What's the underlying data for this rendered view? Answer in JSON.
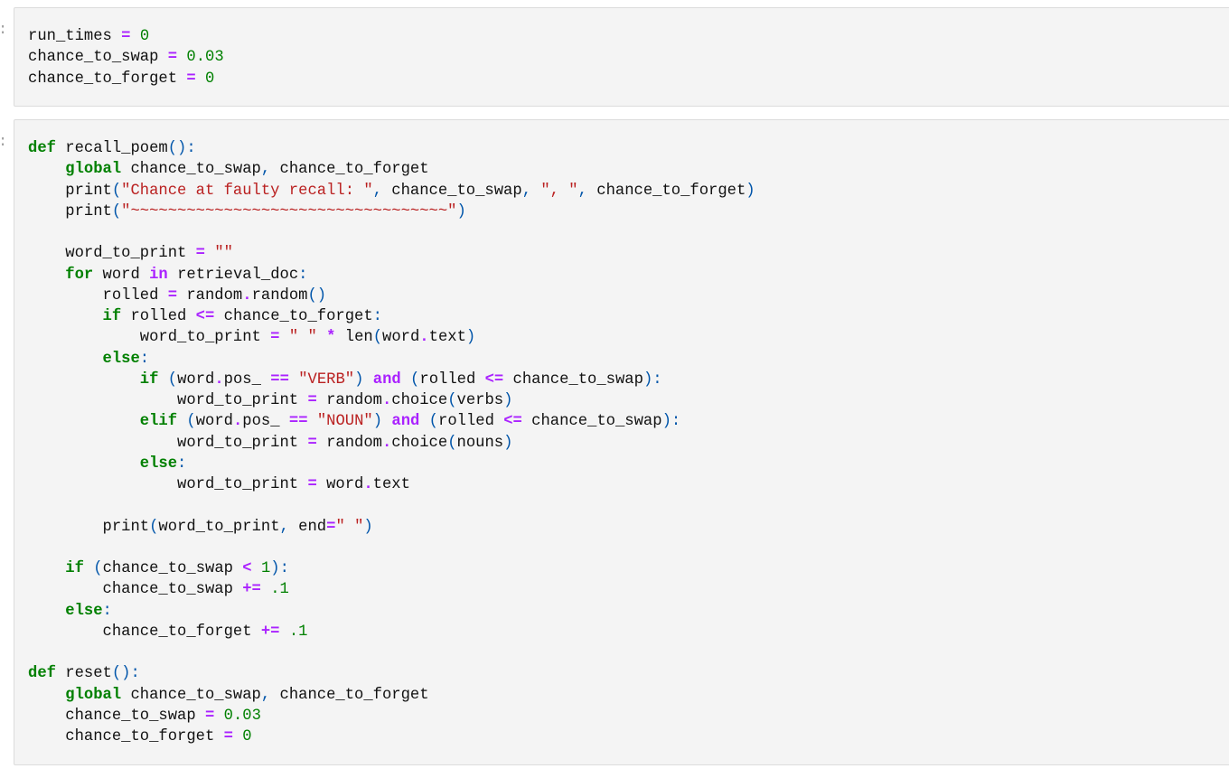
{
  "notebook": {
    "cells": [
      {
        "type": "code",
        "prompt": ":",
        "lines": [
          [
            [
              "t",
              "run_times "
            ],
            [
              "op",
              "="
            ],
            [
              "t",
              " "
            ],
            [
              "num",
              "0"
            ]
          ],
          [
            [
              "t",
              "chance_to_swap "
            ],
            [
              "op",
              "="
            ],
            [
              "t",
              " "
            ],
            [
              "num",
              "0.03"
            ]
          ],
          [
            [
              "t",
              "chance_to_forget "
            ],
            [
              "op",
              "="
            ],
            [
              "t",
              " "
            ],
            [
              "num",
              "0"
            ]
          ]
        ]
      },
      {
        "type": "code",
        "prompt": ":",
        "lines": [
          [
            [
              "kw",
              "def"
            ],
            [
              "t",
              " recall_poem"
            ],
            [
              "pn",
              "():"
            ]
          ],
          [
            [
              "t",
              "    "
            ],
            [
              "kw",
              "global"
            ],
            [
              "t",
              " chance_to_swap"
            ],
            [
              "pn",
              ","
            ],
            [
              "t",
              " chance_to_forget"
            ]
          ],
          [
            [
              "t",
              "    print"
            ],
            [
              "pn",
              "("
            ],
            [
              "str",
              "\"Chance at faulty recall: \""
            ],
            [
              "pn",
              ","
            ],
            [
              "t",
              " chance_to_swap"
            ],
            [
              "pn",
              ","
            ],
            [
              "t",
              " "
            ],
            [
              "str",
              "\", \""
            ],
            [
              "pn",
              ","
            ],
            [
              "t",
              " chance_to_forget"
            ],
            [
              "pn",
              ")"
            ]
          ],
          [
            [
              "t",
              "    print"
            ],
            [
              "pn",
              "("
            ],
            [
              "str",
              "\"~~~~~~~~~~~~~~~~~~~~~~~~~~~~~~~~~~\""
            ],
            [
              "pn",
              ")"
            ]
          ],
          [
            [
              "t",
              ""
            ]
          ],
          [
            [
              "t",
              "    word_to_print "
            ],
            [
              "op",
              "="
            ],
            [
              "t",
              " "
            ],
            [
              "str",
              "\"\""
            ]
          ],
          [
            [
              "t",
              "    "
            ],
            [
              "kw",
              "for"
            ],
            [
              "t",
              " word "
            ],
            [
              "op",
              "in"
            ],
            [
              "t",
              " retrieval_doc"
            ],
            [
              "pn",
              ":"
            ]
          ],
          [
            [
              "t",
              "        rolled "
            ],
            [
              "op",
              "="
            ],
            [
              "t",
              " random"
            ],
            [
              "op",
              "."
            ],
            [
              "t",
              "random"
            ],
            [
              "pn",
              "()"
            ]
          ],
          [
            [
              "t",
              "        "
            ],
            [
              "kw",
              "if"
            ],
            [
              "t",
              " rolled "
            ],
            [
              "op",
              "<="
            ],
            [
              "t",
              " chance_to_forget"
            ],
            [
              "pn",
              ":"
            ]
          ],
          [
            [
              "t",
              "            word_to_print "
            ],
            [
              "op",
              "="
            ],
            [
              "t",
              " "
            ],
            [
              "str",
              "\" \""
            ],
            [
              "t",
              " "
            ],
            [
              "op",
              "*"
            ],
            [
              "t",
              " len"
            ],
            [
              "pn",
              "("
            ],
            [
              "t",
              "word"
            ],
            [
              "op",
              "."
            ],
            [
              "t",
              "text"
            ],
            [
              "pn",
              ")"
            ]
          ],
          [
            [
              "t",
              "        "
            ],
            [
              "kw",
              "else"
            ],
            [
              "pn",
              ":"
            ]
          ],
          [
            [
              "t",
              "            "
            ],
            [
              "kw",
              "if"
            ],
            [
              "t",
              " "
            ],
            [
              "pn",
              "("
            ],
            [
              "t",
              "word"
            ],
            [
              "op",
              "."
            ],
            [
              "t",
              "pos_ "
            ],
            [
              "op",
              "=="
            ],
            [
              "t",
              " "
            ],
            [
              "str",
              "\"VERB\""
            ],
            [
              "pn",
              ")"
            ],
            [
              "t",
              " "
            ],
            [
              "op",
              "and"
            ],
            [
              "t",
              " "
            ],
            [
              "pn",
              "("
            ],
            [
              "t",
              "rolled "
            ],
            [
              "op",
              "<="
            ],
            [
              "t",
              " chance_to_swap"
            ],
            [
              "pn",
              "):"
            ]
          ],
          [
            [
              "t",
              "                word_to_print "
            ],
            [
              "op",
              "="
            ],
            [
              "t",
              " random"
            ],
            [
              "op",
              "."
            ],
            [
              "t",
              "choice"
            ],
            [
              "pn",
              "("
            ],
            [
              "t",
              "verbs"
            ],
            [
              "pn",
              ")"
            ]
          ],
          [
            [
              "t",
              "            "
            ],
            [
              "kw",
              "elif"
            ],
            [
              "t",
              " "
            ],
            [
              "pn",
              "("
            ],
            [
              "t",
              "word"
            ],
            [
              "op",
              "."
            ],
            [
              "t",
              "pos_ "
            ],
            [
              "op",
              "=="
            ],
            [
              "t",
              " "
            ],
            [
              "str",
              "\"NOUN\""
            ],
            [
              "pn",
              ")"
            ],
            [
              "t",
              " "
            ],
            [
              "op",
              "and"
            ],
            [
              "t",
              " "
            ],
            [
              "pn",
              "("
            ],
            [
              "t",
              "rolled "
            ],
            [
              "op",
              "<="
            ],
            [
              "t",
              " chance_to_swap"
            ],
            [
              "pn",
              "):"
            ]
          ],
          [
            [
              "t",
              "                word_to_print "
            ],
            [
              "op",
              "="
            ],
            [
              "t",
              " random"
            ],
            [
              "op",
              "."
            ],
            [
              "t",
              "choice"
            ],
            [
              "pn",
              "("
            ],
            [
              "t",
              "nouns"
            ],
            [
              "pn",
              ")"
            ]
          ],
          [
            [
              "t",
              "            "
            ],
            [
              "kw",
              "else"
            ],
            [
              "pn",
              ":"
            ]
          ],
          [
            [
              "t",
              "                word_to_print "
            ],
            [
              "op",
              "="
            ],
            [
              "t",
              " word"
            ],
            [
              "op",
              "."
            ],
            [
              "t",
              "text"
            ]
          ],
          [
            [
              "t",
              ""
            ]
          ],
          [
            [
              "t",
              "        print"
            ],
            [
              "pn",
              "("
            ],
            [
              "t",
              "word_to_print"
            ],
            [
              "pn",
              ","
            ],
            [
              "t",
              " end"
            ],
            [
              "op",
              "="
            ],
            [
              "str",
              "\" \""
            ],
            [
              "pn",
              ")"
            ]
          ],
          [
            [
              "t",
              ""
            ]
          ],
          [
            [
              "t",
              "    "
            ],
            [
              "kw",
              "if"
            ],
            [
              "t",
              " "
            ],
            [
              "pn",
              "("
            ],
            [
              "t",
              "chance_to_swap "
            ],
            [
              "op",
              "<"
            ],
            [
              "t",
              " "
            ],
            [
              "num",
              "1"
            ],
            [
              "pn",
              "):"
            ]
          ],
          [
            [
              "t",
              "        chance_to_swap "
            ],
            [
              "op",
              "+="
            ],
            [
              "t",
              " "
            ],
            [
              "num",
              ".1"
            ]
          ],
          [
            [
              "t",
              "    "
            ],
            [
              "kw",
              "else"
            ],
            [
              "pn",
              ":"
            ]
          ],
          [
            [
              "t",
              "        chance_to_forget "
            ],
            [
              "op",
              "+="
            ],
            [
              "t",
              " "
            ],
            [
              "num",
              ".1"
            ]
          ],
          [
            [
              "t",
              ""
            ]
          ],
          [
            [
              "kw",
              "def"
            ],
            [
              "t",
              " reset"
            ],
            [
              "pn",
              "():"
            ]
          ],
          [
            [
              "t",
              "    "
            ],
            [
              "kw",
              "global"
            ],
            [
              "t",
              " chance_to_swap"
            ],
            [
              "pn",
              ","
            ],
            [
              "t",
              " chance_to_forget"
            ]
          ],
          [
            [
              "t",
              "    chance_to_swap "
            ],
            [
              "op",
              "="
            ],
            [
              "t",
              " "
            ],
            [
              "num",
              "0.03"
            ]
          ],
          [
            [
              "t",
              "    chance_to_forget "
            ],
            [
              "op",
              "="
            ],
            [
              "t",
              " "
            ],
            [
              "num",
              "0"
            ]
          ]
        ]
      }
    ]
  }
}
